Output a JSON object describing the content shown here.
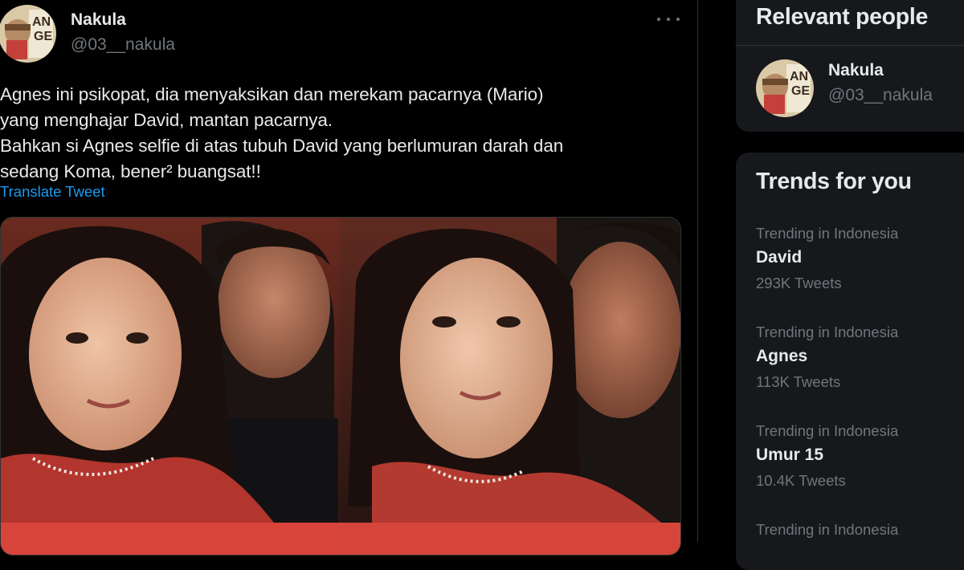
{
  "tweet": {
    "author": {
      "name": "Nakula",
      "handle": "@03__nakula"
    },
    "text": "Agnes ini psikopat, dia menyaksikan dan merekam pacarnya (Mario)\nyang menghajar David, mantan pacarnya.\nBahkan si Agnes selfie di atas tubuh David yang berlumuran darah dan\nsedang Koma, bener² buangsat!!",
    "translate_label": "Translate Tweet",
    "more_icon": "more-horizontal-icon"
  },
  "sidebar": {
    "relevant_people": {
      "title": "Relevant people",
      "person": {
        "name": "Nakula",
        "handle": "@03__nakula"
      }
    },
    "trends": {
      "title": "Trends for you",
      "items": [
        {
          "context": "Trending in Indonesia",
          "topic": "David",
          "count": "293K Tweets"
        },
        {
          "context": "Trending in Indonesia",
          "topic": "Agnes",
          "count": "113K Tweets"
        },
        {
          "context": "Trending in Indonesia",
          "topic": "Umur 15",
          "count": "10.4K Tweets"
        },
        {
          "context": "Trending in Indonesia",
          "topic": "",
          "count": ""
        }
      ]
    }
  },
  "colors": {
    "background": "#000000",
    "panel": "#16181c",
    "text_primary": "#e7e9ea",
    "text_secondary": "#71767b",
    "link": "#1d9bf0"
  }
}
